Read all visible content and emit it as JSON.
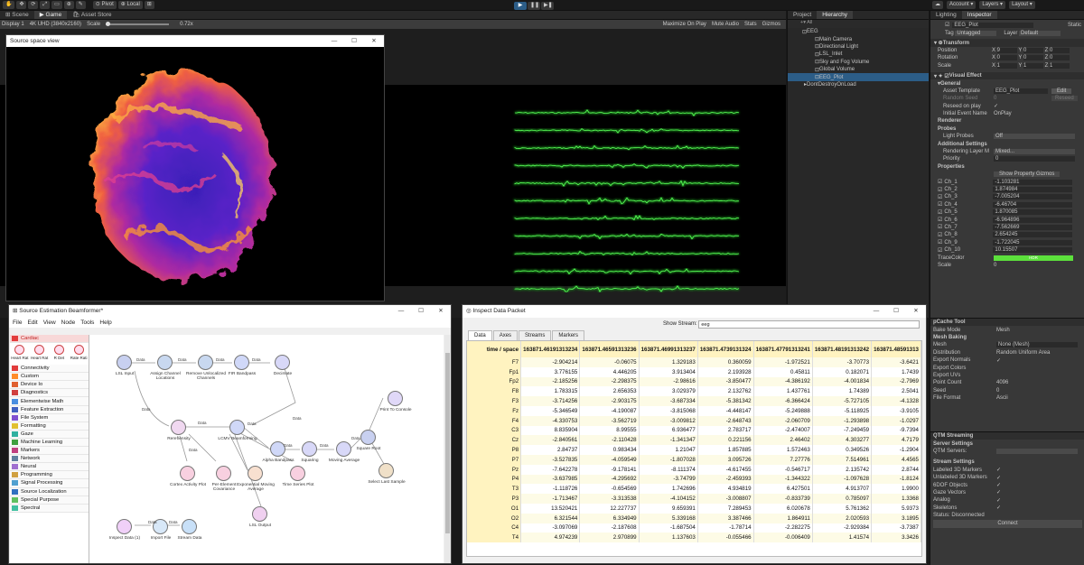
{
  "toolbar": {
    "pivot": "Pivot",
    "local": "Local",
    "account": "Account",
    "layers": "Layers",
    "layout": "Layout"
  },
  "scene_tabs": [
    "Scene",
    "Game",
    "Asset Store"
  ],
  "game_bar": {
    "display": "Display 1",
    "resolution": "4K UHD (3840x2160)",
    "scale_label": "Scale",
    "scale_value": "0.72x",
    "maximize": "Maximize On Play",
    "mute": "Mute Audio",
    "stats": "Stats",
    "gizmos": "Gizmos"
  },
  "source_view": {
    "title": "Source space view"
  },
  "hierarchy": {
    "tabs": [
      "Project",
      "Hierarchy"
    ],
    "search": "All",
    "items": [
      "EEG",
      "Main Camera",
      "Directional Light",
      "LSL_Inlet",
      "Sky and Fog Volume",
      "Global Volume",
      "EEG_Plot",
      "DontDestroyOnLoad"
    ]
  },
  "inspector": {
    "tabs": [
      "Lighting",
      "Inspector"
    ],
    "object_name": "EEG_Plot",
    "static": "Static",
    "tag_label": "Tag",
    "tag": "Untagged",
    "layer_label": "Layer",
    "layer": "Default",
    "transform": "Transform",
    "position": "Position",
    "rotation": "Rotation",
    "scale": "Scale",
    "pos": [
      "9",
      "0",
      "0"
    ],
    "rot": [
      "0",
      "0",
      "0"
    ],
    "scl": [
      "1",
      "1",
      "1"
    ],
    "visual_effect": "Visual Effect",
    "general": "General",
    "asset_template": "Asset Template",
    "asset_template_value": "EEG_Plot",
    "edit": "Edit",
    "random_seed": "Random Seed",
    "random_seed_value": "0",
    "reseed": "Reseed",
    "reseed_on_play": "Reseed on play",
    "initial_event": "Initial Event Name",
    "initial_event_value": "OnPlay",
    "renderer": "Renderer",
    "probes": "Probes",
    "light_probes": "Light Probes",
    "light_probes_value": "Off",
    "additional": "Additional Settings",
    "rendering_layer": "Rendering Layer M",
    "rendering_layer_value": "Mixed...",
    "priority": "Priority",
    "priority_value": "0",
    "properties": "Properties",
    "show_gizmos": "Show Property Gizmos",
    "channels": [
      {
        "n": "Ch_1",
        "v": "-1.103281"
      },
      {
        "n": "Ch_2",
        "v": "1.874984"
      },
      {
        "n": "Ch_3",
        "v": "-7.005204"
      },
      {
        "n": "Ch_4",
        "v": "-6.46704"
      },
      {
        "n": "Ch_5",
        "v": "1.870085"
      },
      {
        "n": "Ch_6",
        "v": "-6.964896"
      },
      {
        "n": "Ch_7",
        "v": "-7.562669"
      },
      {
        "n": "Ch_8",
        "v": "2.654245"
      },
      {
        "n": "Ch_9",
        "v": "-1.722045"
      },
      {
        "n": "Ch_10",
        "v": "10.15507"
      }
    ],
    "trace_color": "TraceColor",
    "hdr": "HDR",
    "scale_prop": "Scale",
    "scale_prop_value": "0"
  },
  "pcache": {
    "header": "pCache Tool",
    "bake_mode": "Bake Mode",
    "bake_mode_value": "Mesh",
    "mesh_baking": "Mesh Baking",
    "mesh": "Mesh",
    "mesh_value": "None (Mesh)",
    "distribution": "Distribution",
    "distribution_value": "Random Uniform Area",
    "export_normals": "Export Normals",
    "export_colors": "Export Colors",
    "export_uvs": "Export UVs",
    "point_count": "Point Count",
    "point_count_value": "4096",
    "seed": "Seed",
    "seed_value": "0",
    "file_format": "File Format",
    "file_format_value": "Ascii"
  },
  "qtm": {
    "header": "QTM Streaming",
    "server_settings": "Server Settings",
    "qtm_servers": "QTM Servers:",
    "stream_settings": "Stream Settings",
    "opts": [
      "Labeled 3D Markers",
      "Unlabeled 3D Markers",
      "6DOF Objects",
      "Gaze Vectors",
      "Analog",
      "Skeletons"
    ],
    "status": "Status: Disconnected",
    "connect": "Connect"
  },
  "beamformer": {
    "title": "Source Estimation Beamformer*",
    "menu": [
      "File",
      "Edit",
      "View",
      "Node",
      "Tools",
      "Help"
    ],
    "cardiac": "Cardiac",
    "cardiac_icons": [
      "Heart Rat",
      "Heart Rat",
      "R Det",
      "Rate Rati"
    ],
    "categories": [
      {
        "l": "Connectivity",
        "c": "#e23c3c"
      },
      {
        "l": "Custom",
        "c": "#ff8c2a"
      },
      {
        "l": "Device Io",
        "c": "#e06030"
      },
      {
        "l": "Diagnostics",
        "c": "#d04040"
      },
      {
        "l": "Elementwise Math",
        "c": "#4a8ee0"
      },
      {
        "l": "Feature Extraction",
        "c": "#4060c0"
      },
      {
        "l": "File System",
        "c": "#8050d0"
      },
      {
        "l": "Formatting",
        "c": "#e0c030"
      },
      {
        "l": "Gaze",
        "c": "#30b0a0"
      },
      {
        "l": "Machine Learning",
        "c": "#40a040"
      },
      {
        "l": "Markers",
        "c": "#c04080"
      },
      {
        "l": "Network",
        "c": "#6080a0"
      },
      {
        "l": "Neural",
        "c": "#a070d0"
      },
      {
        "l": "Programming",
        "c": "#d0a040"
      },
      {
        "l": "Signal Processing",
        "c": "#50a0d0"
      },
      {
        "l": "Source Localization",
        "c": "#3070c0"
      },
      {
        "l": "Special Purpose",
        "c": "#60c060"
      },
      {
        "l": "Spectral",
        "c": "#40c0a0"
      }
    ],
    "nodes": [
      "LSL Input",
      "Assign Channel Locations",
      "Remove Unlocalized Channels",
      "FIR Bandpass",
      "Decimate",
      "Print To Console",
      "Reref/ensity",
      "LCMV Beamforming",
      "Alpha Bandpass",
      "Squaring",
      "Moving Average",
      "Square Root",
      "Select Last Sample",
      "Cortex Activity Plot",
      "Per-Element Covariance",
      "Exponential Moving Average",
      "Time Series Plot",
      "LSL Output",
      "Inspect Data (1)",
      "Import File",
      "Stream Data",
      "LSL Output"
    ],
    "edge_labels": [
      "Data",
      "Data",
      "Data",
      "Data",
      "Data",
      "Data",
      "Data",
      "Data",
      "Data",
      "Data",
      "Data",
      "Data",
      "Data",
      "Data"
    ]
  },
  "inspect": {
    "title": "Inspect Data Packet",
    "show_stream": "Show Stream:",
    "stream": "eeg",
    "tabs": [
      "Data",
      "Axes",
      "Streams",
      "Markers"
    ],
    "header": [
      "time / space",
      "163871.46191313234",
      "163871.46591313236",
      "163871.46991313237",
      "163871.4739131324",
      "163871.47791313241",
      "163871.48191313242",
      "163871.48591313"
    ],
    "rows": [
      [
        "F7",
        "-2.904214",
        "-0.06075",
        "1.329183",
        "0.360059",
        "-1.972521",
        "-3.70773",
        "-3.6421"
      ],
      [
        "Fp1",
        "3.776155",
        "4.446205",
        "3.913404",
        "2.193928",
        "0.45811",
        "0.182071",
        "1.7439"
      ],
      [
        "Fp2",
        "-2.185256",
        "-2.298375",
        "-2.98616",
        "-3.850477",
        "-4.386192",
        "-4.001834",
        "-2.7969"
      ],
      [
        "F8",
        "1.783315",
        "2.656353",
        "3.029379",
        "2.132762",
        "1.437761",
        "1.74389",
        "2.5041"
      ],
      [
        "F3",
        "-3.714256",
        "-2.903175",
        "-3.687334",
        "-5.381342",
        "-6.366424",
        "-5.727105",
        "-4.1328"
      ],
      [
        "Fz",
        "-5.346549",
        "-4.190087",
        "-3.815068",
        "-4.448147",
        "-5.249888",
        "-5.118925",
        "-3.9105"
      ],
      [
        "F4",
        "-4.330753",
        "-3.562719",
        "-3.009812",
        "-2.648743",
        "-2.060709",
        "-1.293898",
        "-1.0297"
      ],
      [
        "C3",
        "8.835904",
        "8.99555",
        "6.936477",
        "2.783717",
        "-2.474007",
        "-7.249459",
        "-9.7394"
      ],
      [
        "Cz",
        "-2.840561",
        "-2.110428",
        "-1.341347",
        "0.221156",
        "2.46402",
        "4.303277",
        "4.7179"
      ],
      [
        "P8",
        "2.84737",
        "0.983434",
        "1.21047",
        "1.857885",
        "1.572463",
        "0.349526",
        "-1.2904"
      ],
      [
        "P7",
        "-3.527835",
        "-4.059549",
        "-1.807028",
        "3.095726",
        "7.27776",
        "7.514961",
        "4.4565"
      ],
      [
        "Pz",
        "-7.642278",
        "-9.178141",
        "-8.111374",
        "-4.617455",
        "-0.546717",
        "2.135742",
        "2.8744"
      ],
      [
        "P4",
        "-3.637985",
        "-4.295692",
        "-3.74799",
        "-2.459393",
        "-1.344322",
        "-1.097628",
        "-1.8124"
      ],
      [
        "T3",
        "-1.118726",
        "-0.654569",
        "1.742696",
        "4.934819",
        "6.427501",
        "4.913707",
        "1.9900"
      ],
      [
        "P3",
        "-1.713467",
        "-3.313538",
        "-4.104152",
        "-3.008807",
        "-0.833739",
        "0.785097",
        "1.3368"
      ],
      [
        "O1",
        "13.520421",
        "12.227737",
        "9.659391",
        "7.289453",
        "6.020678",
        "5.761362",
        "5.9373"
      ],
      [
        "O2",
        "6.321544",
        "6.334949",
        "5.339168",
        "3.387466",
        "1.864911",
        "2.020593",
        "3.1895"
      ],
      [
        "C4",
        "-3.097069",
        "-2.187608",
        "-1.687504",
        "-1.78714",
        "-2.282275",
        "-2.929384",
        "-3.7387"
      ],
      [
        "T4",
        "4.974239",
        "2.970899",
        "1.137603",
        "-0.055466",
        "-0.006409",
        "1.41574",
        "3.3426"
      ]
    ]
  },
  "colors": {
    "unity_bg": "#191919",
    "panel": "#383838",
    "accent": "#2c5d87",
    "eeg_trace": "#3cff3c",
    "trace_color": "#5ce03c",
    "header_yellow": "#fff3c0"
  }
}
